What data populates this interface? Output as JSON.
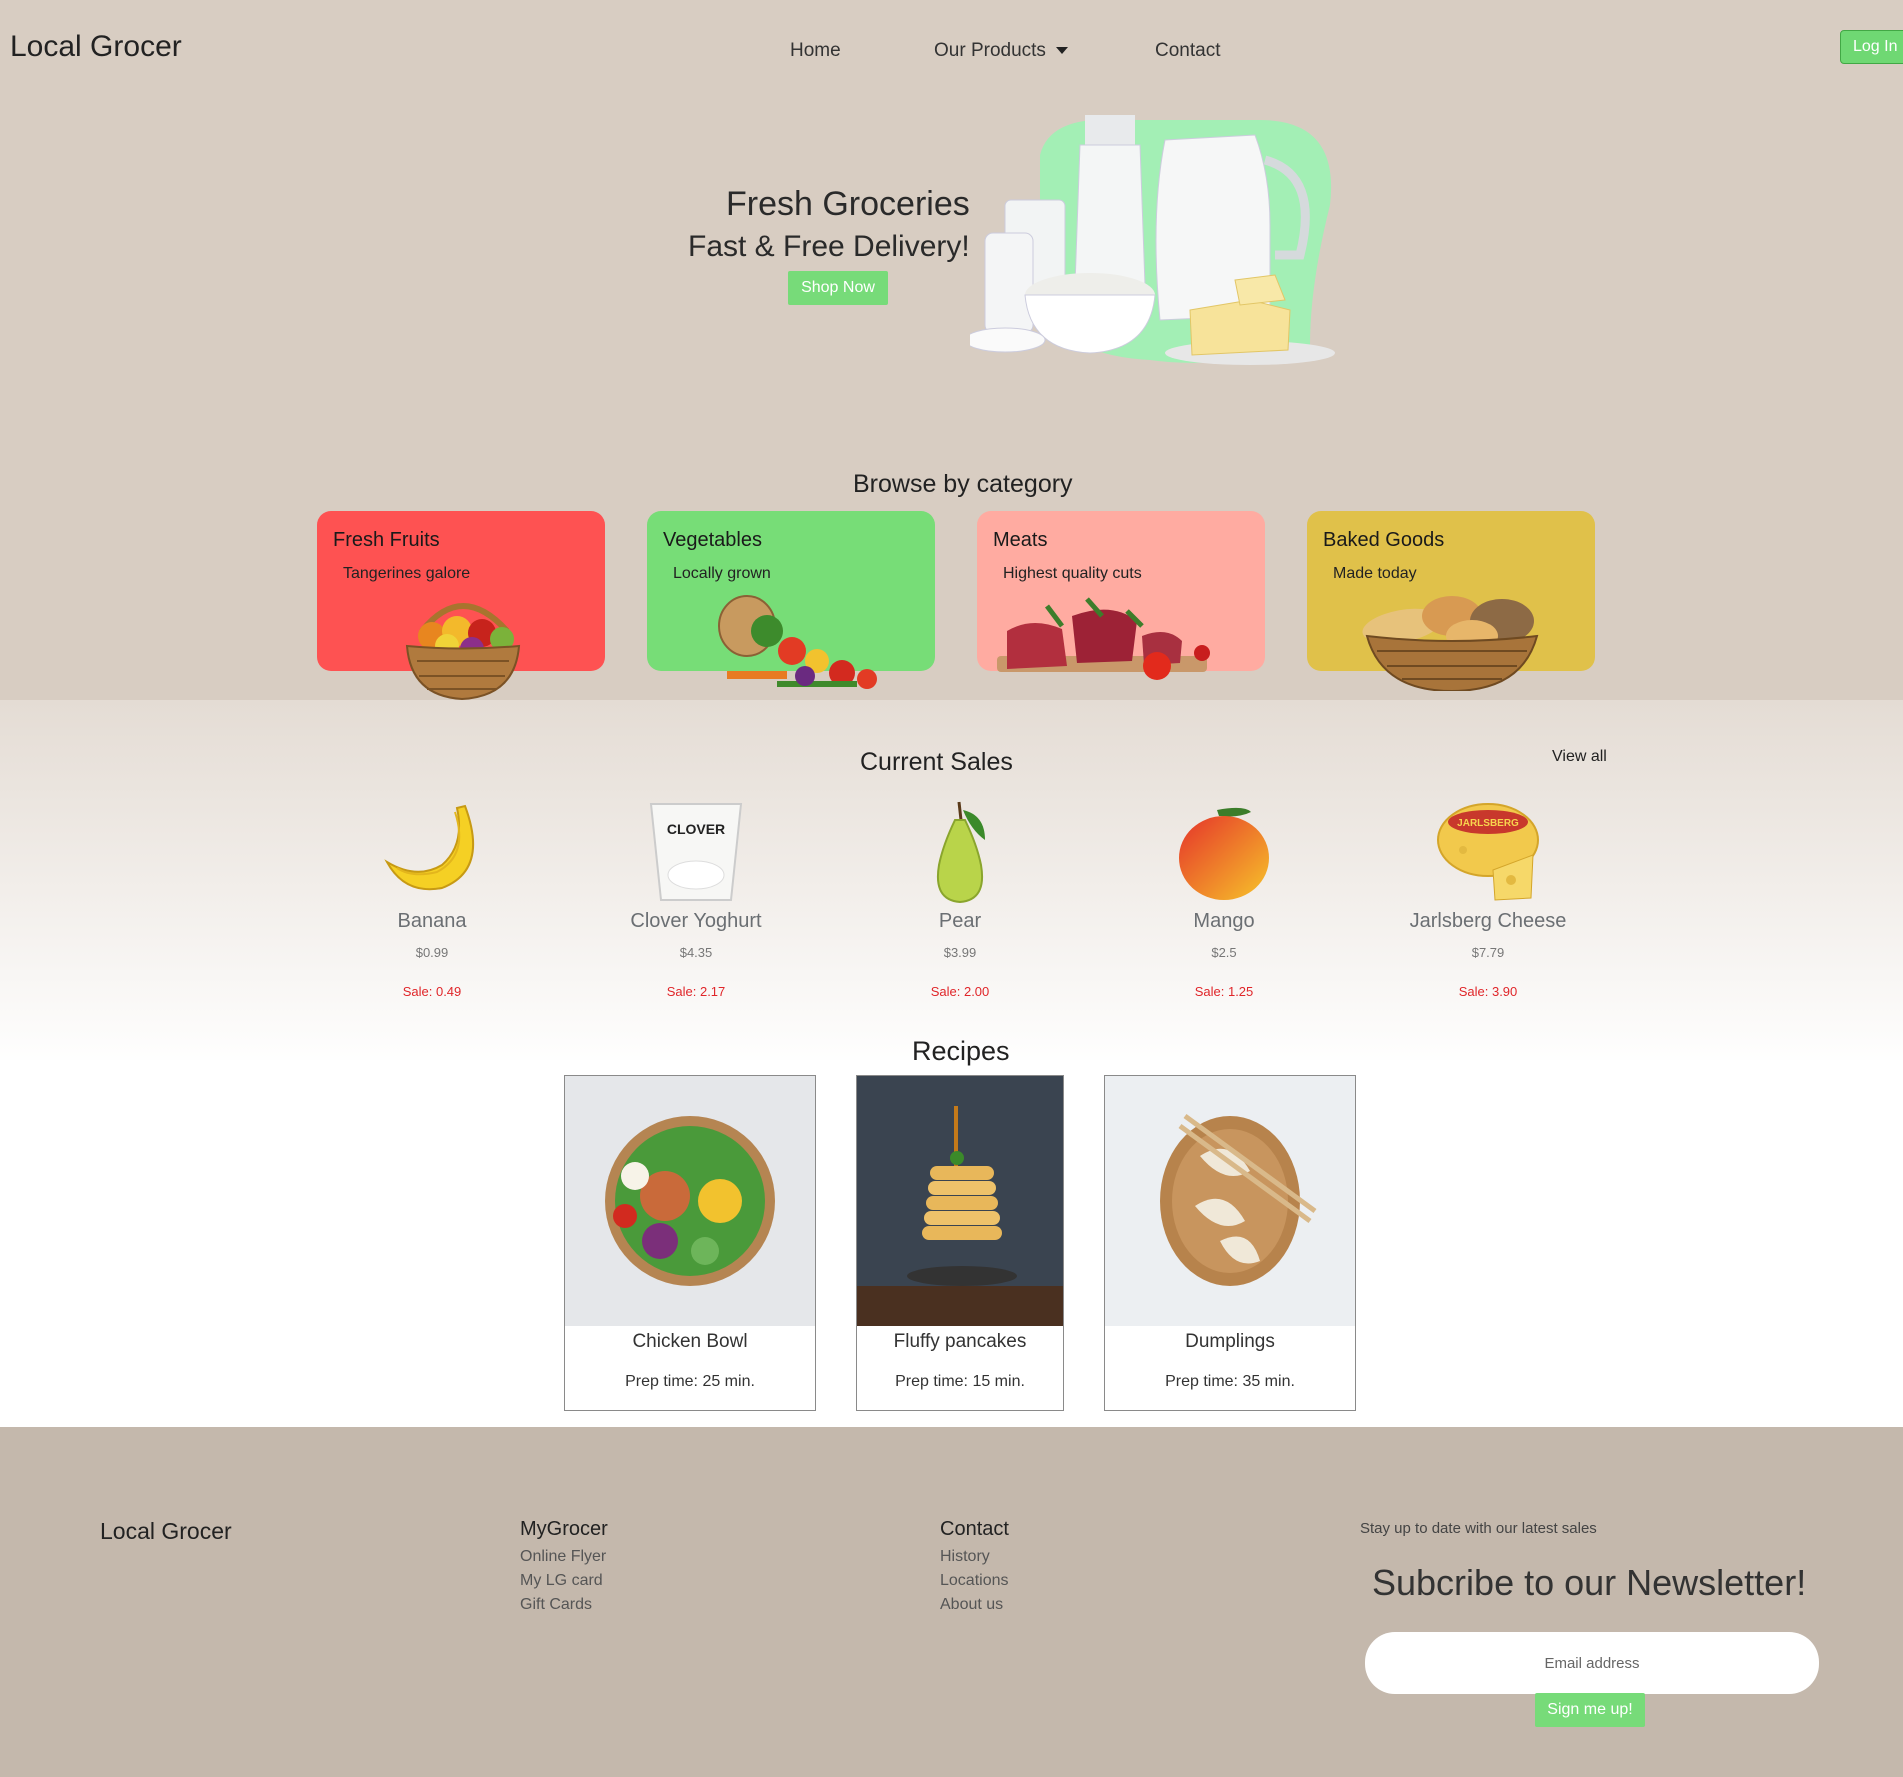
{
  "nav": {
    "brand": "Local Grocer",
    "home": "Home",
    "products": "Our Products",
    "contact": "Contact",
    "login": "Log In"
  },
  "hero": {
    "title": "Fresh Groceries",
    "subtitle": "Fast & Free Delivery!",
    "cta": "Shop Now"
  },
  "categories": {
    "heading": "Browse by category",
    "items": [
      {
        "title": "Fresh Fruits",
        "subtitle": "Tangerines galore",
        "color": "#fe5252"
      },
      {
        "title": "Vegetables",
        "subtitle": "Locally grown",
        "color": "#77dd77"
      },
      {
        "title": "Meats",
        "subtitle": "Highest quality cuts",
        "color": "#ffaba1"
      },
      {
        "title": "Baked Goods",
        "subtitle": "Made today",
        "color": "#e0c14a"
      }
    ]
  },
  "sales": {
    "heading": "Current Sales",
    "view_all": "View all",
    "items": [
      {
        "name": "Banana",
        "price": "$0.99",
        "sale": "Sale: 0.49"
      },
      {
        "name": "Clover Yoghurt",
        "price": "$4.35",
        "sale": "Sale: 2.17"
      },
      {
        "name": "Pear",
        "price": "$3.99",
        "sale": "Sale: 2.00"
      },
      {
        "name": "Mango",
        "price": "$2.5",
        "sale": "Sale: 1.25"
      },
      {
        "name": "Jarlsberg Cheese",
        "price": "$7.79",
        "sale": "Sale: 3.90"
      }
    ]
  },
  "recipes": {
    "heading": "Recipes",
    "items": [
      {
        "name": "Chicken Bowl",
        "prep": "Prep time: 25 min."
      },
      {
        "name": "Fluffy pancakes",
        "prep": "Prep time: 15 min."
      },
      {
        "name": "Dumplings",
        "prep": "Prep time: 35 min."
      }
    ]
  },
  "footer": {
    "brand": "Local Grocer",
    "col1": {
      "heading": "MyGrocer",
      "links": [
        "Online Flyer",
        "My LG card",
        "Gift Cards"
      ]
    },
    "col2": {
      "heading": "Contact",
      "links": [
        "History",
        "Locations",
        "About us"
      ]
    },
    "note": "Stay up to date with our latest sales",
    "newsletter": "Subcribe to our Newsletter!",
    "email_placeholder": "Email address",
    "signup": "Sign me up!"
  },
  "colors": {
    "accent": "#77db79",
    "page_bg": "#d8cdc2",
    "footer_bg": "#c4b8ac",
    "sale_red": "#e0262a"
  }
}
